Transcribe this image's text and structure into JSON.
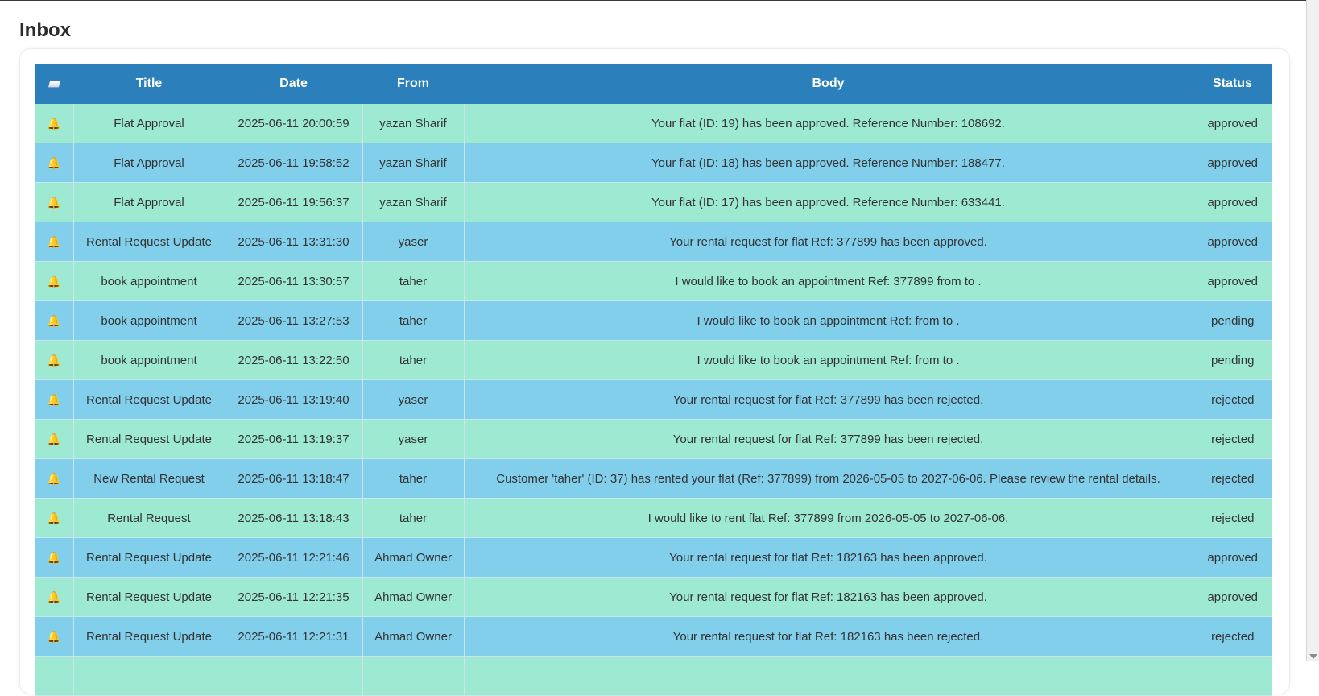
{
  "page": {
    "title": "Inbox"
  },
  "table": {
    "headers": {
      "select": "",
      "title": "Title",
      "date": "Date",
      "from": "From",
      "body": "Body",
      "status": "Status"
    },
    "rows": [
      {
        "title": "Flat Approval",
        "date": "2025-06-11 20:00:59",
        "from": "yazan Sharif",
        "body": "Your flat (ID: 19) has been approved. Reference Number: 108692.",
        "status": "approved"
      },
      {
        "title": "Flat Approval",
        "date": "2025-06-11 19:58:52",
        "from": "yazan Sharif",
        "body": "Your flat (ID: 18) has been approved. Reference Number: 188477.",
        "status": "approved"
      },
      {
        "title": "Flat Approval",
        "date": "2025-06-11 19:56:37",
        "from": "yazan Sharif",
        "body": "Your flat (ID: 17) has been approved. Reference Number: 633441.",
        "status": "approved"
      },
      {
        "title": "Rental Request Update",
        "date": "2025-06-11 13:31:30",
        "from": "yaser",
        "body": "Your rental request for flat Ref: 377899 has been approved.",
        "status": "approved"
      },
      {
        "title": "book appointment",
        "date": "2025-06-11 13:30:57",
        "from": "taher",
        "body": "I would like to book an appointment Ref: 377899 from to .",
        "status": "approved"
      },
      {
        "title": "book appointment",
        "date": "2025-06-11 13:27:53",
        "from": "taher",
        "body": "I would like to book an appointment Ref: from to .",
        "status": "pending"
      },
      {
        "title": "book appointment",
        "date": "2025-06-11 13:22:50",
        "from": "taher",
        "body": "I would like to book an appointment Ref: from to .",
        "status": "pending"
      },
      {
        "title": "Rental Request Update",
        "date": "2025-06-11 13:19:40",
        "from": "yaser",
        "body": "Your rental request for flat Ref: 377899 has been rejected.",
        "status": "rejected"
      },
      {
        "title": "Rental Request Update",
        "date": "2025-06-11 13:19:37",
        "from": "yaser",
        "body": "Your rental request for flat Ref: 377899 has been rejected.",
        "status": "rejected"
      },
      {
        "title": "New Rental Request",
        "date": "2025-06-11 13:18:47",
        "from": "taher",
        "body": "Customer 'taher' (ID: 37) has rented your flat (Ref: 377899) from 2026-05-05 to 2027-06-06. Please review the rental details.",
        "status": "rejected"
      },
      {
        "title": "Rental Request",
        "date": "2025-06-11 13:18:43",
        "from": "taher",
        "body": "I would like to rent flat Ref: 377899 from 2026-05-05 to 2027-06-06.",
        "status": "rejected"
      },
      {
        "title": "Rental Request Update",
        "date": "2025-06-11 12:21:46",
        "from": "Ahmad Owner",
        "body": "Your rental request for flat Ref: 182163 has been approved.",
        "status": "approved"
      },
      {
        "title": "Rental Request Update",
        "date": "2025-06-11 12:21:35",
        "from": "Ahmad Owner",
        "body": "Your rental request for flat Ref: 182163 has been approved.",
        "status": "approved"
      },
      {
        "title": "Rental Request Update",
        "date": "2025-06-11 12:21:31",
        "from": "Ahmad Owner",
        "body": "Your rental request for flat Ref: 182163 has been rejected.",
        "status": "rejected"
      },
      {
        "title": "",
        "date": "",
        "from": "",
        "body": "",
        "status": ""
      }
    ]
  },
  "icons": {
    "row_icon": "bell-icon",
    "select_icon": "select-all-icon"
  },
  "colors": {
    "header": "#2b7fba",
    "row_even": "#9de9d2",
    "row_odd": "#82cfec",
    "bell": "#e9a319"
  }
}
